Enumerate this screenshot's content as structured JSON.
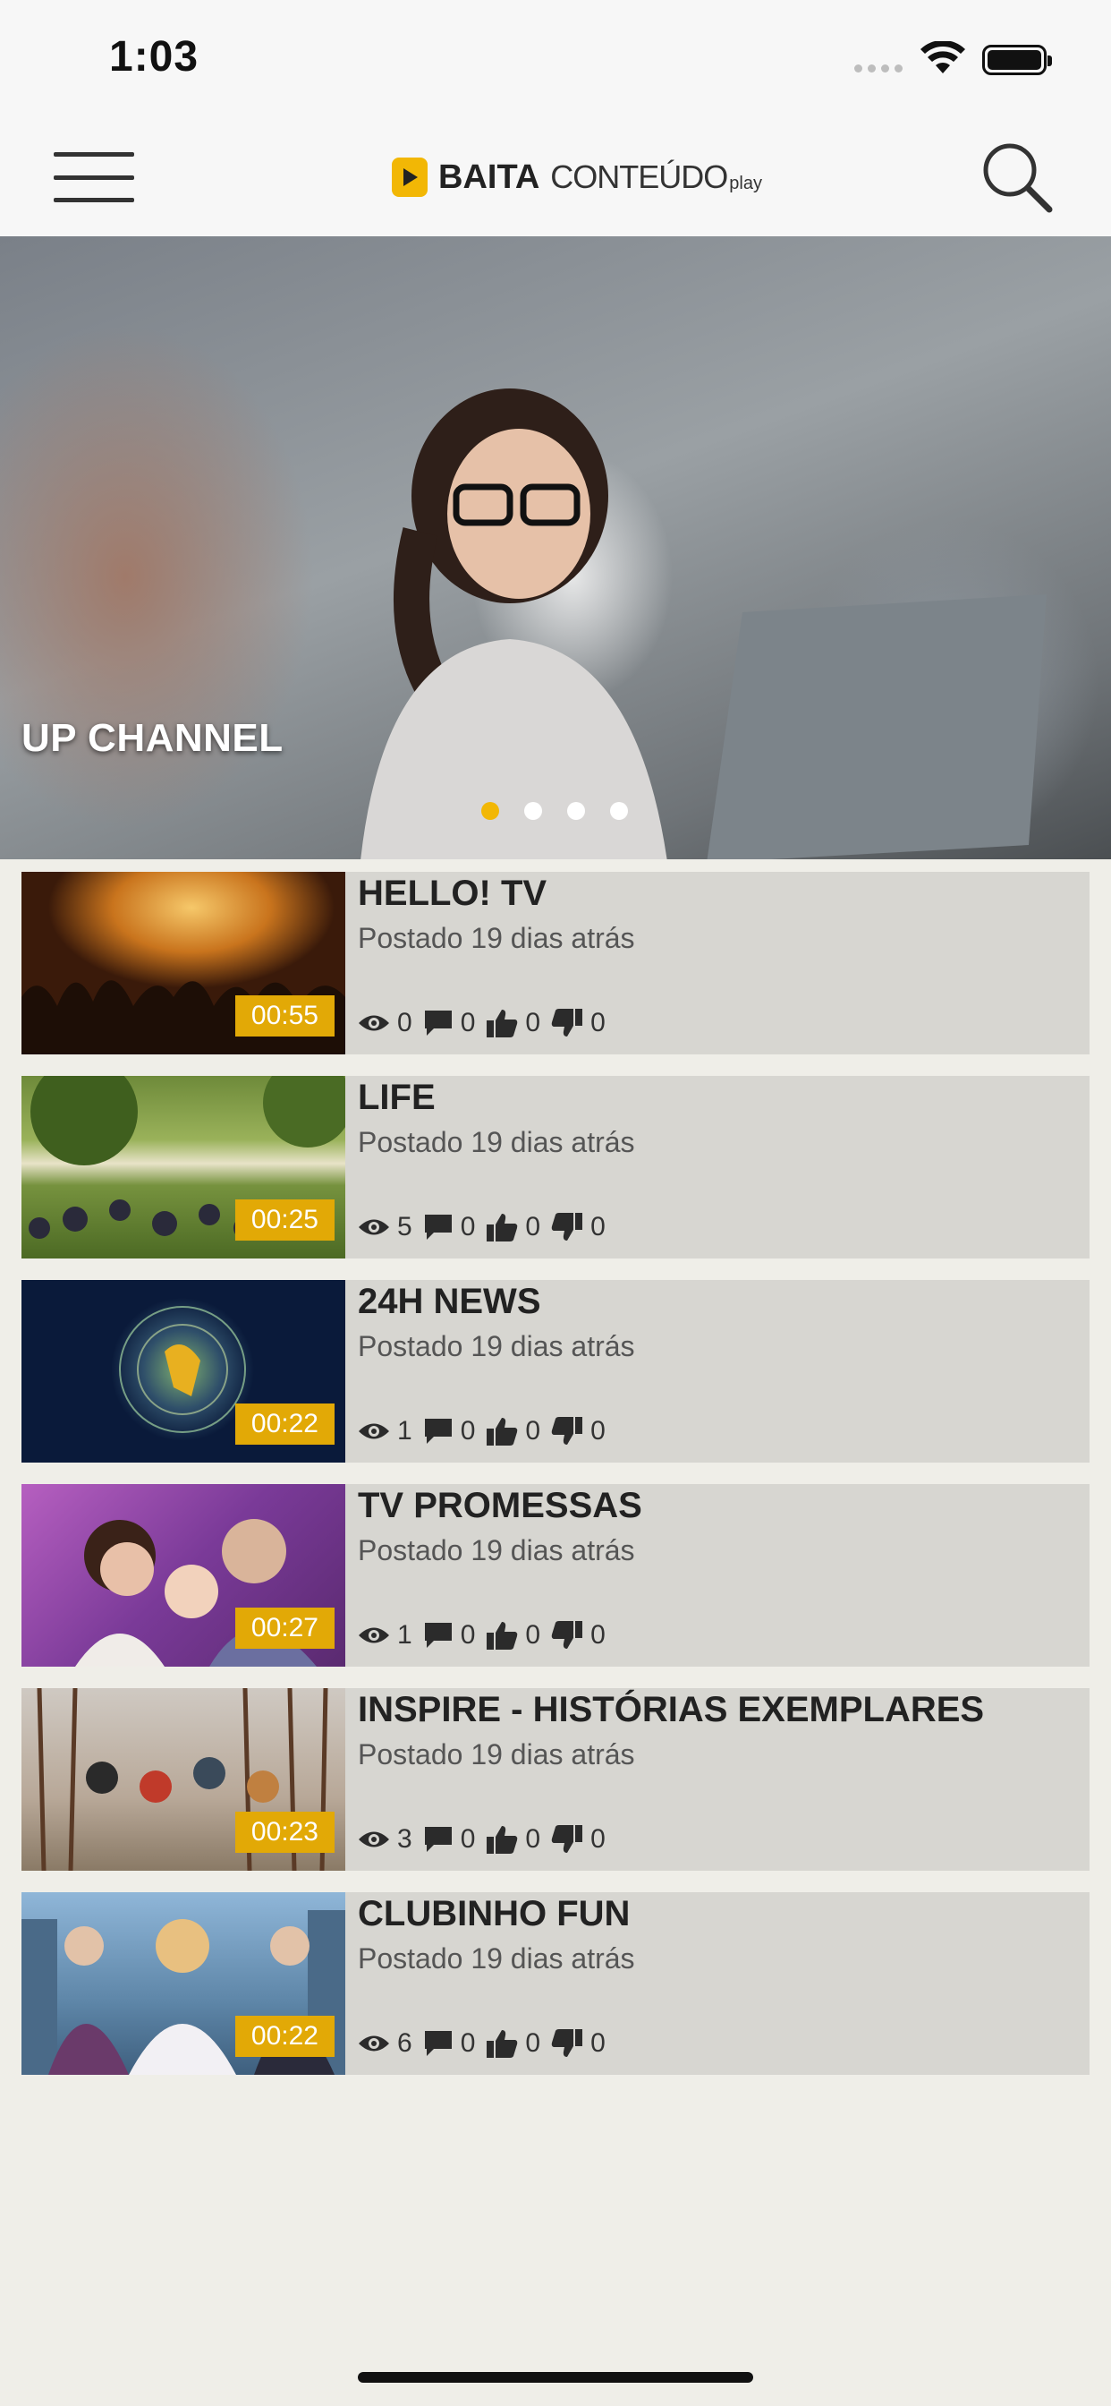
{
  "status": {
    "time": "1:03"
  },
  "header": {
    "logo_strong": "BAITA",
    "logo_light": "CONTEÚDO",
    "logo_play": "play"
  },
  "hero": {
    "title": "UP CHANNEL",
    "slides": 4,
    "active_slide": 1
  },
  "colors": {
    "accent": "#f2b705",
    "card_bg": "#d7d6d1",
    "page_bg": "#efeee8"
  },
  "items": [
    {
      "title": "HELLO! TV",
      "date": "Postado 19 dias atrás",
      "duration": "00:55",
      "views": "0",
      "comments": "0",
      "likes": "0",
      "dislikes": "0"
    },
    {
      "title": "LIFE",
      "date": "Postado 19 dias atrás",
      "duration": "00:25",
      "views": "5",
      "comments": "0",
      "likes": "0",
      "dislikes": "0"
    },
    {
      "title": "24H NEWS",
      "date": "Postado 19 dias atrás",
      "duration": "00:22",
      "views": "1",
      "comments": "0",
      "likes": "0",
      "dislikes": "0"
    },
    {
      "title": "TV PROMESSAS",
      "date": "Postado 19 dias atrás",
      "duration": "00:27",
      "views": "1",
      "comments": "0",
      "likes": "0",
      "dislikes": "0"
    },
    {
      "title": "INSPIRE - HISTÓRIAS EXEMPLARES",
      "date": "Postado 19 dias atrás",
      "duration": "00:23",
      "views": "3",
      "comments": "0",
      "likes": "0",
      "dislikes": "0"
    },
    {
      "title": "CLUBINHO FUN",
      "date": "Postado 19 dias atrás",
      "duration": "00:22",
      "views": "6",
      "comments": "0",
      "likes": "0",
      "dislikes": "0"
    }
  ]
}
